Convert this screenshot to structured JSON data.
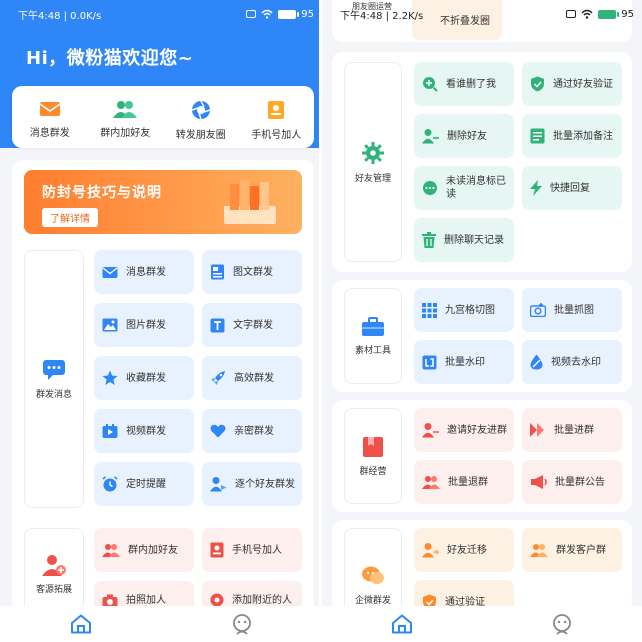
{
  "left": {
    "status": {
      "time": "下午4:48 | 0.0K/s",
      "battery": "95"
    },
    "greeting": "Hi，微粉猫欢迎您~",
    "quick": [
      {
        "label": "消息群发",
        "icon": "envelope-icon"
      },
      {
        "label": "群内加好友",
        "icon": "group-users-icon"
      },
      {
        "label": "转发朋友圈",
        "icon": "aperture-icon"
      },
      {
        "label": "手机号加人",
        "icon": "contact-card-icon"
      }
    ],
    "banner": {
      "title": "防封号技巧与说明",
      "button": "了解详情"
    },
    "categories": [
      {
        "label": "群发消息",
        "icon": "chat-bubble-icon"
      },
      {
        "label": "客源拓展",
        "icon": "add-user-icon"
      }
    ],
    "mass_tiles": [
      "消息群发",
      "图文群发",
      "图片群发",
      "文字群发",
      "收藏群发",
      "高效群发",
      "视频群发",
      "亲密群发",
      "定时提醒",
      "逐个好友群发"
    ],
    "expand_tiles": [
      "群内加好友",
      "手机号加人",
      "拍照加人",
      "添加附近的人"
    ]
  },
  "right": {
    "status": {
      "time": "下午4:48 | 2.2K/s",
      "battery": "95"
    },
    "overlay_title": "朋友圈运营",
    "top_partial_tile": "不折叠发圈",
    "sections": [
      {
        "label": "好友管理",
        "icon": "gear-icon",
        "tiles": [
          "看谁删了我",
          "通过好友验证",
          "删除好友",
          "批量添加备注",
          "未读消息标已读",
          "快捷回复",
          "删除聊天记录"
        ]
      },
      {
        "label": "素材工具",
        "icon": "toolbox-icon",
        "tiles": [
          "九宫格切图",
          "批量抓图",
          "批量水印",
          "视频去水印"
        ]
      },
      {
        "label": "群经营",
        "icon": "bookmark-icon",
        "tiles": [
          "邀请好友进群",
          "批量进群",
          "批量退群",
          "批量群公告"
        ]
      },
      {
        "label": "企微群发",
        "icon": "wecom-chat-icon",
        "tiles": [
          "好友迁移",
          "群发客户群",
          "通过验证"
        ]
      }
    ]
  },
  "colors": {
    "primary": "#2f86f6",
    "orange": "#ff7d2e",
    "mint": "#2fb37b",
    "red": "#f0504a"
  }
}
